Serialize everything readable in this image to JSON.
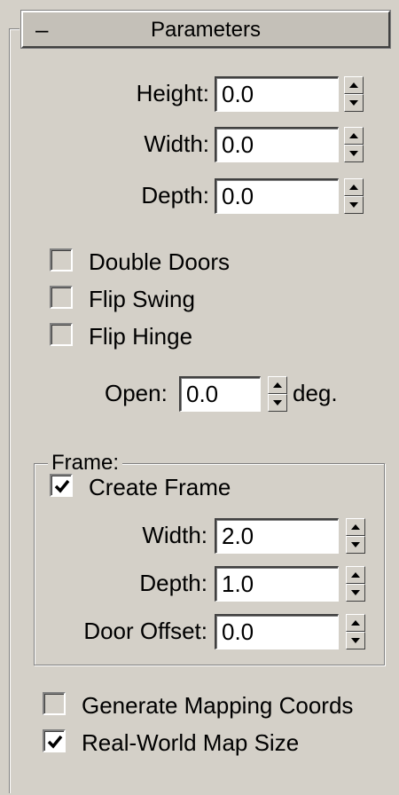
{
  "rollout": {
    "collapse_symbol": "–",
    "title": "Parameters"
  },
  "params": {
    "height": {
      "label": "Height:",
      "value": "0.0"
    },
    "width": {
      "label": "Width:",
      "value": "0.0"
    },
    "depth": {
      "label": "Depth:",
      "value": "0.0"
    }
  },
  "options": {
    "double_doors": {
      "label": "Double Doors",
      "checked": false
    },
    "flip_swing": {
      "label": "Flip Swing",
      "checked": false
    },
    "flip_hinge": {
      "label": "Flip Hinge",
      "checked": false
    }
  },
  "open": {
    "label": "Open:",
    "value": "0.0",
    "unit": "deg."
  },
  "frame": {
    "group_title": "Frame:",
    "create_frame": {
      "label": "Create Frame",
      "checked": true
    },
    "width": {
      "label": "Width:",
      "value": "2.0"
    },
    "depth": {
      "label": "Depth:",
      "value": "1.0"
    },
    "door_offset": {
      "label": "Door Offset:",
      "value": "0.0"
    }
  },
  "mapping": {
    "generate_coords": {
      "label": "Generate Mapping Coords",
      "checked": false
    },
    "real_world": {
      "label": "Real-World Map Size",
      "checked": true
    }
  },
  "icons": {
    "spinner_up": "triangle-up-icon",
    "spinner_down": "triangle-down-icon",
    "check": "checkmark-icon"
  }
}
